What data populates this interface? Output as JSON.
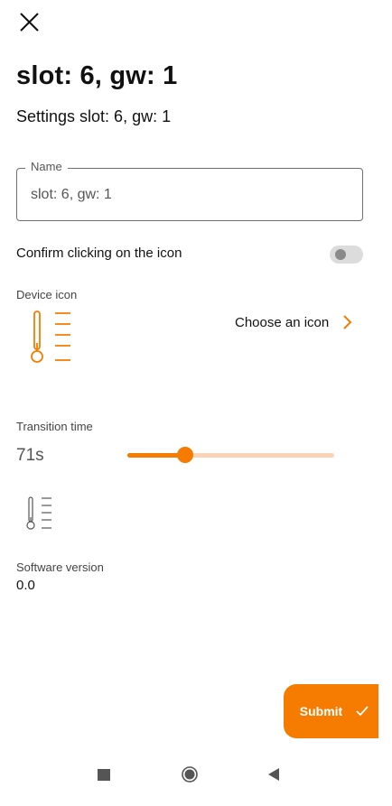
{
  "header": {
    "title": "slot: 6, gw: 1",
    "subtitle": "Settings slot: 6, gw: 1"
  },
  "name_field": {
    "label": "Name",
    "value": "slot: 6, gw: 1"
  },
  "confirm_click": {
    "label": "Confirm clicking on the icon",
    "enabled": false
  },
  "device_icon": {
    "label": "Device icon",
    "icon": "thermometer-scale-icon",
    "choose_label": "Choose an icon"
  },
  "transition_time": {
    "label": "Transition time",
    "value": "71s",
    "slider_fraction": 0.28
  },
  "software_version": {
    "label": "Software version",
    "value": "0.0"
  },
  "submit": {
    "label": "Submit"
  },
  "colors": {
    "accent": "#f57c00",
    "accent_light": "#fbd3b7",
    "text": "#111111",
    "muted": "#555555"
  }
}
